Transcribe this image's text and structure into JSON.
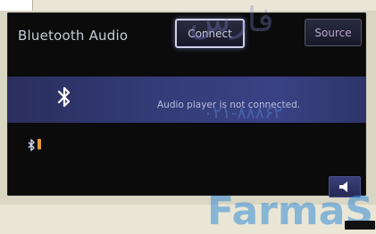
{
  "screen": {
    "title": "Bluetooth Audio",
    "connect_label": "Connect",
    "source_label": "Source",
    "status_text": "Audio player is not connected."
  },
  "icons": {
    "bluetooth": "bluetooth-icon",
    "phone_status": "bluetooth-status-icon",
    "signal": "signal-icon",
    "volume": "speaker-icon"
  },
  "watermark": {
    "top": "فارس",
    "bottom": "FarmaS",
    "number": "۰۲۱-۸۸۸۶۲"
  },
  "colors": {
    "band": "#353c78",
    "connect_border": "#cfd2e8",
    "signal": "#e19a3a",
    "watermark": "#378cd7"
  }
}
